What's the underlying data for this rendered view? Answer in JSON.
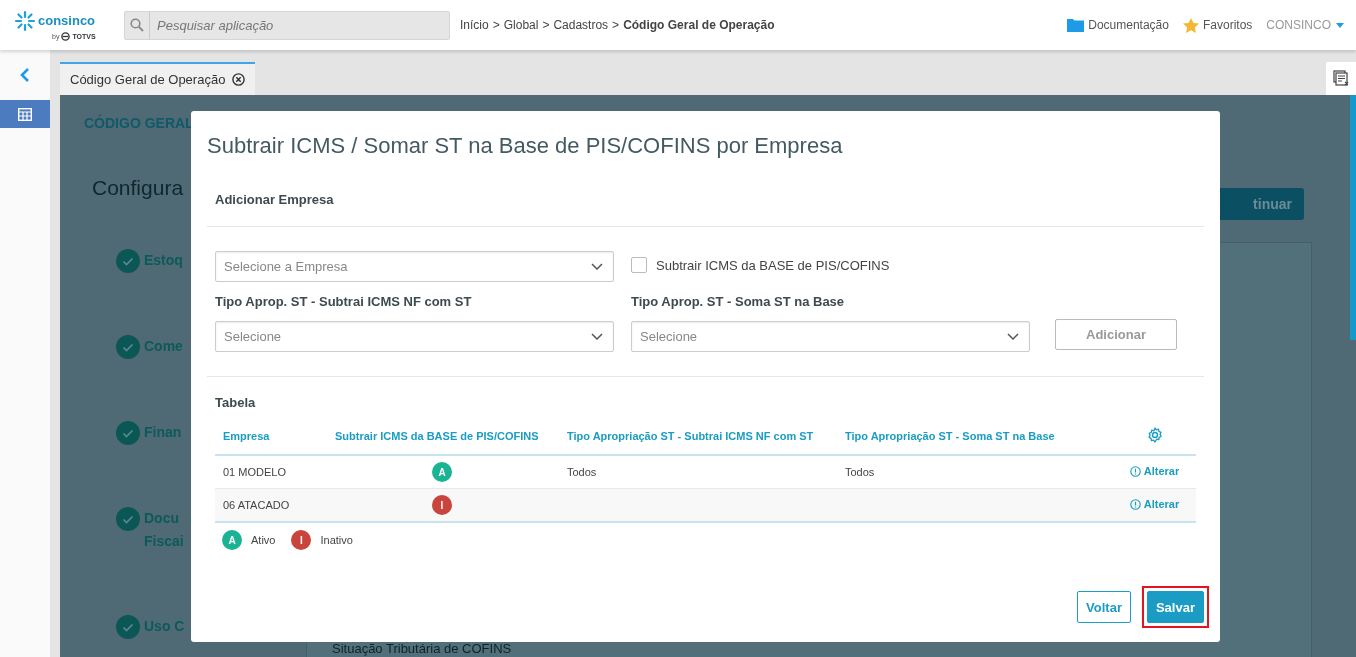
{
  "header": {
    "logo": {
      "name": "consinco",
      "by": "by",
      "brand": "TOTVS"
    },
    "search": {
      "placeholder": "Pesquisar aplicação"
    },
    "breadcrumbs": [
      {
        "label": "Início",
        "current": false
      },
      {
        "label": "Global",
        "current": false
      },
      {
        "label": "Cadastros",
        "current": false
      },
      {
        "label": "Código Geral de Operação",
        "current": true
      }
    ],
    "separator": ">",
    "links": [
      {
        "kind": "folder",
        "label": "Documentação"
      },
      {
        "kind": "star",
        "label": "Favoritos"
      }
    ],
    "user": "CONSINCO"
  },
  "tabs": [
    {
      "label": "Código Geral de Operação",
      "selected": true
    }
  ],
  "background": {
    "heading": "CÓDIGO GERAL",
    "title": "Configura",
    "continue_button": "tinuar",
    "steps": [
      {
        "lines": [
          "Estoq"
        ]
      },
      {
        "lines": [
          "Come"
        ]
      },
      {
        "lines": [
          "Finan"
        ]
      },
      {
        "lines": [
          "Docu",
          "Fiscai"
        ]
      },
      {
        "lines": [
          "Uso C"
        ]
      }
    ],
    "section_title": "Situação Tributária de COFINS"
  },
  "modal": {
    "title": "Subtrair ICMS / Somar ST na Base de PIS/COFINS por Empresa",
    "section": "Adicionar Empresa",
    "company_select": {
      "placeholder": "Selecione a Empresa"
    },
    "checkbox": {
      "label": "Subtrair ICMS da BASE de PIS/COFINS",
      "checked": false
    },
    "fields": [
      {
        "label": "Tipo Aprop. ST - Subtrai ICMS NF com ST",
        "placeholder": "Selecione"
      },
      {
        "label": "Tipo Aprop. ST - Soma ST na Base",
        "placeholder": "Selecione"
      }
    ],
    "add_button": {
      "label": "Adicionar",
      "disabled": true
    },
    "table": {
      "title": "Tabela",
      "columns": [
        "Empresa",
        "Subtrair ICMS da BASE de PIS/COFINS",
        "Tipo Apropriação ST - Subtrai ICMS NF com ST",
        "Tipo Apropriação ST - Soma ST na Base"
      ],
      "rows": [
        {
          "company": "01 MODELO",
          "status": {
            "letter": "A",
            "color": "#1ab394"
          },
          "subtrai": "Todos",
          "soma": "Todos",
          "action": "Alterar"
        },
        {
          "company": "06 ATACADO",
          "status": {
            "letter": "I",
            "color": "#c9443c"
          },
          "subtrai": "",
          "soma": "",
          "action": "Alterar"
        }
      ]
    },
    "legend": [
      {
        "letter": "A",
        "label": "Ativo",
        "color": "#1ab394"
      },
      {
        "letter": "I",
        "label": "Inativo",
        "color": "#c9443c"
      }
    ],
    "buttons": [
      {
        "label": "Voltar",
        "kind": "outline",
        "highlighted": false
      },
      {
        "label": "Salvar",
        "kind": "primary",
        "highlighted": true
      }
    ]
  }
}
